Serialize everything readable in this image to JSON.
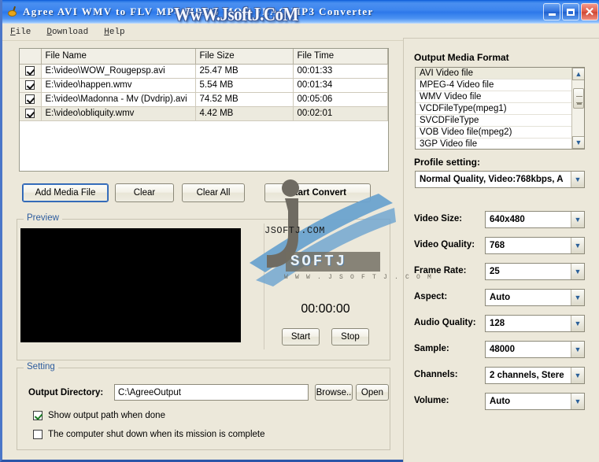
{
  "window": {
    "title": "Agree AVI WMV to FLV MP4 MPEG MOV FLAC MP3 Converter",
    "icon": "app-icon",
    "controls": {
      "minimize": "minimize-button",
      "maximize": "maximize-button",
      "close": "close-button"
    }
  },
  "watermark": {
    "title_text": "WwW.JsoftJ.CoM",
    "url_text": "JSOFTJ.COM",
    "logo_text": "SOFTJ",
    "logo_sub": "W W W . J S O F T J . C O M"
  },
  "menu": {
    "items": [
      {
        "accel": "F",
        "rest": "ile"
      },
      {
        "accel": "D",
        "rest": "ownload"
      },
      {
        "accel": "H",
        "rest": "elp"
      }
    ]
  },
  "filelist": {
    "columns": [
      "",
      "File Name",
      "File Size",
      "File Time"
    ],
    "rows": [
      {
        "checked": true,
        "name": "E:\\video\\WOW_Rougepsp.avi",
        "size": "25.47 MB",
        "time": "00:01:33",
        "selected": false
      },
      {
        "checked": true,
        "name": "E:\\video\\happen.wmv",
        "size": "5.54 MB",
        "time": "00:01:34",
        "selected": false
      },
      {
        "checked": true,
        "name": "E:\\video\\Madonna - Mv (Dvdrip).avi",
        "size": "74.52 MB",
        "time": "00:05:06",
        "selected": false
      },
      {
        "checked": true,
        "name": "E:\\video\\obliquity.wmv",
        "size": "4.42 MB",
        "time": "00:02:01",
        "selected": true
      }
    ]
  },
  "actions": {
    "add_media": "Add Media File",
    "clear": "Clear",
    "clear_all": "Clear All",
    "start_convert": "Start Convert"
  },
  "preview": {
    "title": "Preview",
    "timer": "00:00:00",
    "start": "Start",
    "stop": "Stop"
  },
  "setting": {
    "title": "Setting",
    "output_directory_label": "Output Directory:",
    "output_directory_value": "C:\\AgreeOutput",
    "browse": "Browse..",
    "open": "Open",
    "show_output_path": {
      "label": "Show output path when done",
      "checked": true
    },
    "shutdown": {
      "label": "The computer shut down when its mission is complete",
      "checked": false
    }
  },
  "output_format": {
    "title": "Output Media Format",
    "items": [
      "AVI Video file",
      "MPEG-4 Video file",
      "WMV Video file",
      "VCDFileType(mpeg1)",
      "SVCDFileType",
      "VOB Video file(mpeg2)",
      "3GP Video file"
    ],
    "selected_index": 0,
    "scroll_up_icon": "chevron-up-icon",
    "scroll_down_icon": "chevron-down-icon"
  },
  "profile": {
    "label": "Profile setting:",
    "value": "Normal Quality, Video:768kbps, A"
  },
  "fields": [
    {
      "label": "Video Size:",
      "value": "640x480"
    },
    {
      "label": "Video Quality:",
      "value": "768"
    },
    {
      "label": "Frame Rate:",
      "value": "25"
    },
    {
      "label": "Aspect:",
      "value": "Auto"
    },
    {
      "label": "Audio Quality:",
      "value": "128"
    },
    {
      "label": "Sample:",
      "value": "48000"
    },
    {
      "label": "Channels:",
      "value": "2 channels, Stere"
    },
    {
      "label": "Volume:",
      "value": "Auto"
    }
  ],
  "colors": {
    "window_background": "#ece8da",
    "titlebar_blue": "#2f7ce8",
    "group_title_blue": "#2d5c9e",
    "preview_screen": "#000000",
    "close_button_red": "#d9432f"
  }
}
